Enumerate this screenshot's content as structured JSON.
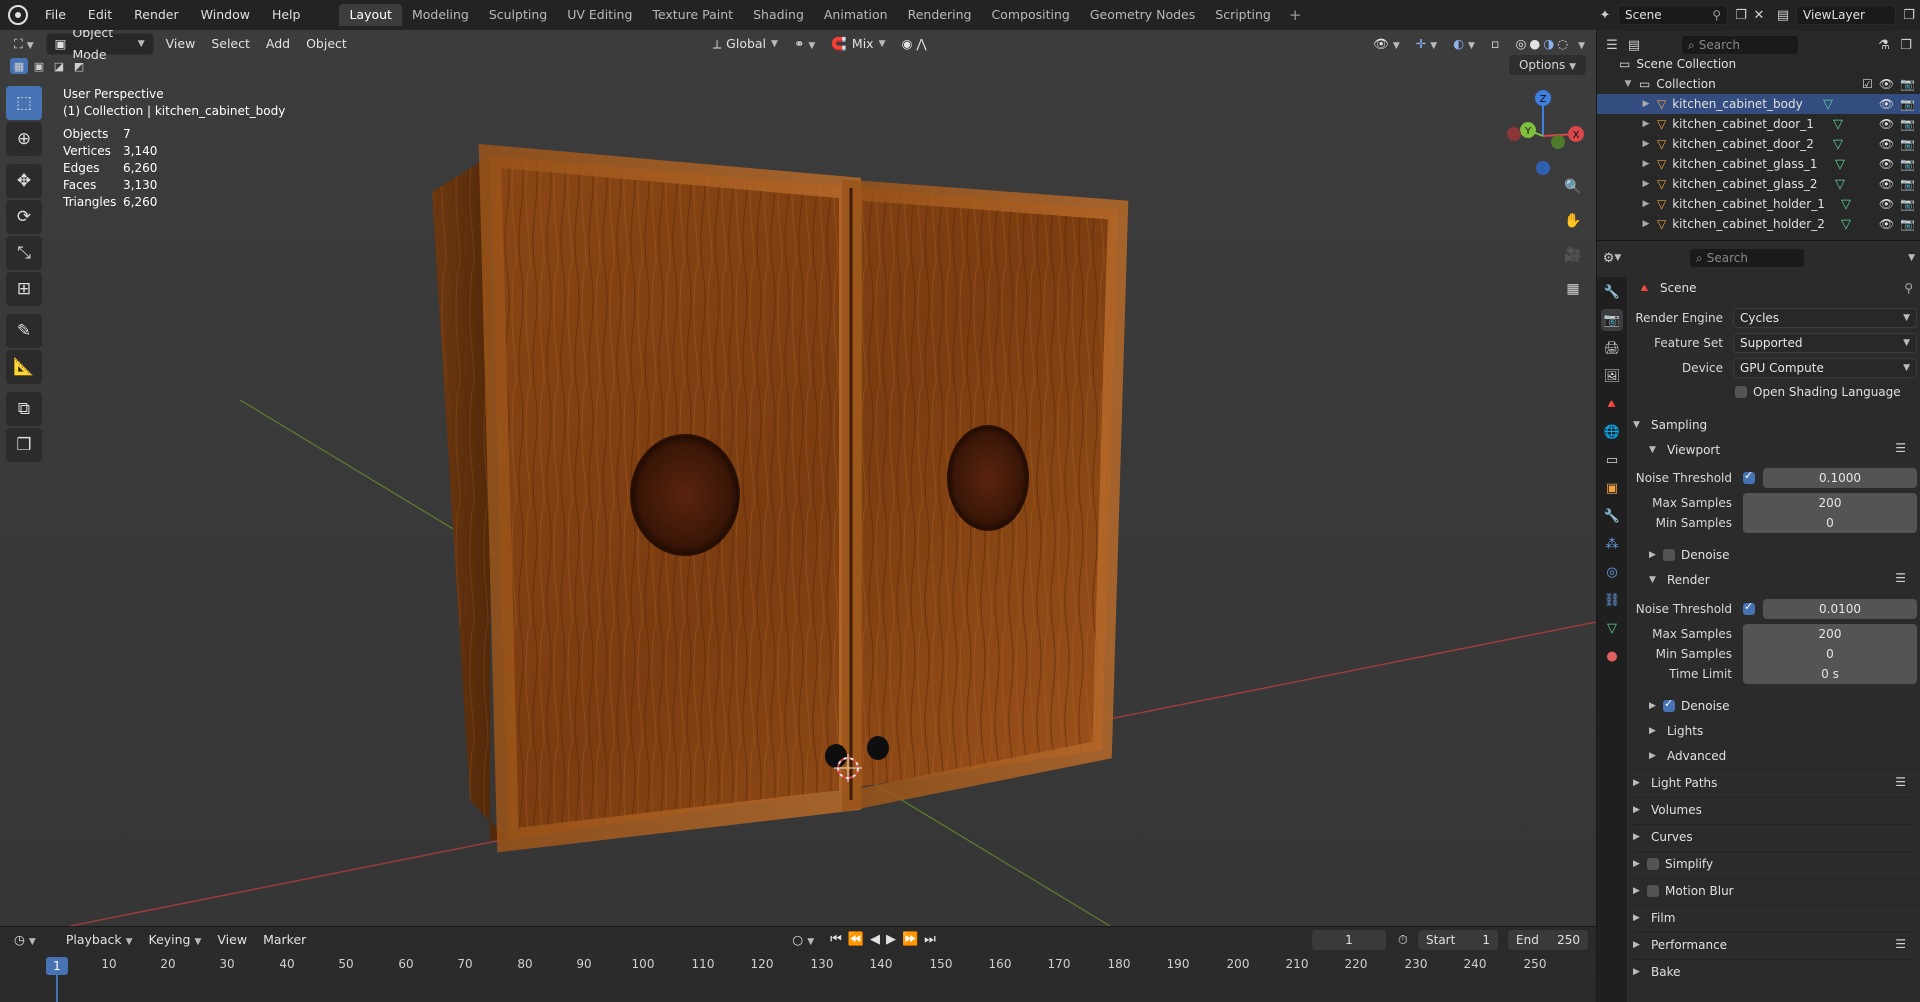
{
  "menu": [
    "File",
    "Edit",
    "Render",
    "Window",
    "Help"
  ],
  "workspaces": [
    "Layout",
    "Modeling",
    "Sculpting",
    "UV Editing",
    "Texture Paint",
    "Shading",
    "Animation",
    "Rendering",
    "Compositing",
    "Geometry Nodes",
    "Scripting"
  ],
  "workspace_add": "+",
  "scene_name": "Scene",
  "view_layer": "ViewLayer",
  "viewport": {
    "mode": "Object Mode",
    "menus": [
      "View",
      "Select",
      "Add",
      "Object"
    ],
    "orientation": "Global",
    "snap_mode": "Mix",
    "options": "Options",
    "perspective": "User Perspective",
    "active_path": "(1) Collection | kitchen_cabinet_body",
    "stats": [
      {
        "label": "Objects",
        "value": "7"
      },
      {
        "label": "Vertices",
        "value": "3,140"
      },
      {
        "label": "Edges",
        "value": "6,260"
      },
      {
        "label": "Faces",
        "value": "3,130"
      },
      {
        "label": "Triangles",
        "value": "6,260"
      }
    ],
    "gizmo": {
      "x": "X",
      "y": "Y",
      "z": "Z"
    }
  },
  "timeline": {
    "menus": [
      "Playback",
      "Keying",
      "View",
      "Marker"
    ],
    "current_frame": "1",
    "start_label": "Start",
    "start": "1",
    "end_label": "End",
    "end": "250",
    "ticks": [
      "10",
      "20",
      "30",
      "40",
      "50",
      "60",
      "70",
      "80",
      "90",
      "100",
      "110",
      "120",
      "130",
      "140",
      "150",
      "160",
      "170",
      "180",
      "190",
      "200",
      "210",
      "220",
      "230",
      "240",
      "250"
    ]
  },
  "outliner": {
    "search_placeholder": "Search",
    "root": "Scene Collection",
    "collection": "Collection",
    "objects": [
      "kitchen_cabinet_body",
      "kitchen_cabinet_door_1",
      "kitchen_cabinet_door_2",
      "kitchen_cabinet_glass_1",
      "kitchen_cabinet_glass_2",
      "kitchen_cabinet_holder_1",
      "kitchen_cabinet_holder_2"
    ],
    "selected_index": 0
  },
  "properties": {
    "search_placeholder": "Search",
    "context": "Scene",
    "render_engine_label": "Render Engine",
    "render_engine": "Cycles",
    "feature_set_label": "Feature Set",
    "feature_set": "Supported",
    "device_label": "Device",
    "device": "GPU Compute",
    "osl_label": "Open Shading Language",
    "sampling": "Sampling",
    "viewport_panel": "Viewport",
    "render_panel": "Render",
    "noise_threshold_label": "Noise Threshold",
    "max_samples_label": "Max Samples",
    "min_samples_label": "Min Samples",
    "time_limit_label": "Time Limit",
    "denoise_label": "Denoise",
    "viewport_noise_threshold": "0.1000",
    "viewport_max_samples": "200",
    "viewport_min_samples": "0",
    "render_noise_threshold": "0.0100",
    "render_max_samples": "200",
    "render_min_samples": "0",
    "render_time_limit": "0 s",
    "lights": "Lights",
    "advanced": "Advanced",
    "sections": [
      "Light Paths",
      "Volumes",
      "Curves",
      "Simplify",
      "Motion Blur",
      "Film",
      "Performance",
      "Bake"
    ]
  },
  "colors": {
    "accent": "#4772b3",
    "wood": "#7a3d12",
    "axis_x": "#d8474a",
    "axis_y": "#7ec03e",
    "axis_z": "#3e7fe0"
  }
}
